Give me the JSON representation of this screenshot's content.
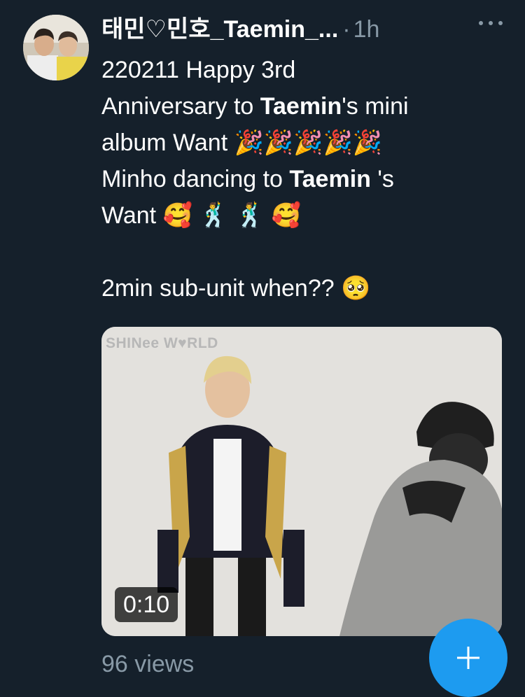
{
  "tweet": {
    "author_name": "태민♡민호_Taemin_...",
    "separator": "·",
    "time": "1h",
    "text_segments": [
      {
        "text": "220211 Happy 3rd\nAnniversary to ",
        "bold": false
      },
      {
        "text": "Taemin",
        "bold": true
      },
      {
        "text": "'s mini\nalbum Want 🎉🎉🎉🎉🎉\nMinho dancing to ",
        "bold": false
      },
      {
        "text": "Taemin",
        "bold": true
      },
      {
        "text": " 's\nWant 🥰 🕺 🕺 🥰\n\n2min sub-unit when?? 🥺",
        "bold": false
      }
    ],
    "media": {
      "watermark": "SHINee W♥RLD",
      "duration": "0:10"
    },
    "views": "96 views"
  },
  "icons": {
    "more": "more-horizontal-icon",
    "fab": "plus-icon"
  },
  "colors": {
    "background": "#15202b",
    "secondary_text": "#8899a6",
    "accent": "#1d9bf0"
  }
}
